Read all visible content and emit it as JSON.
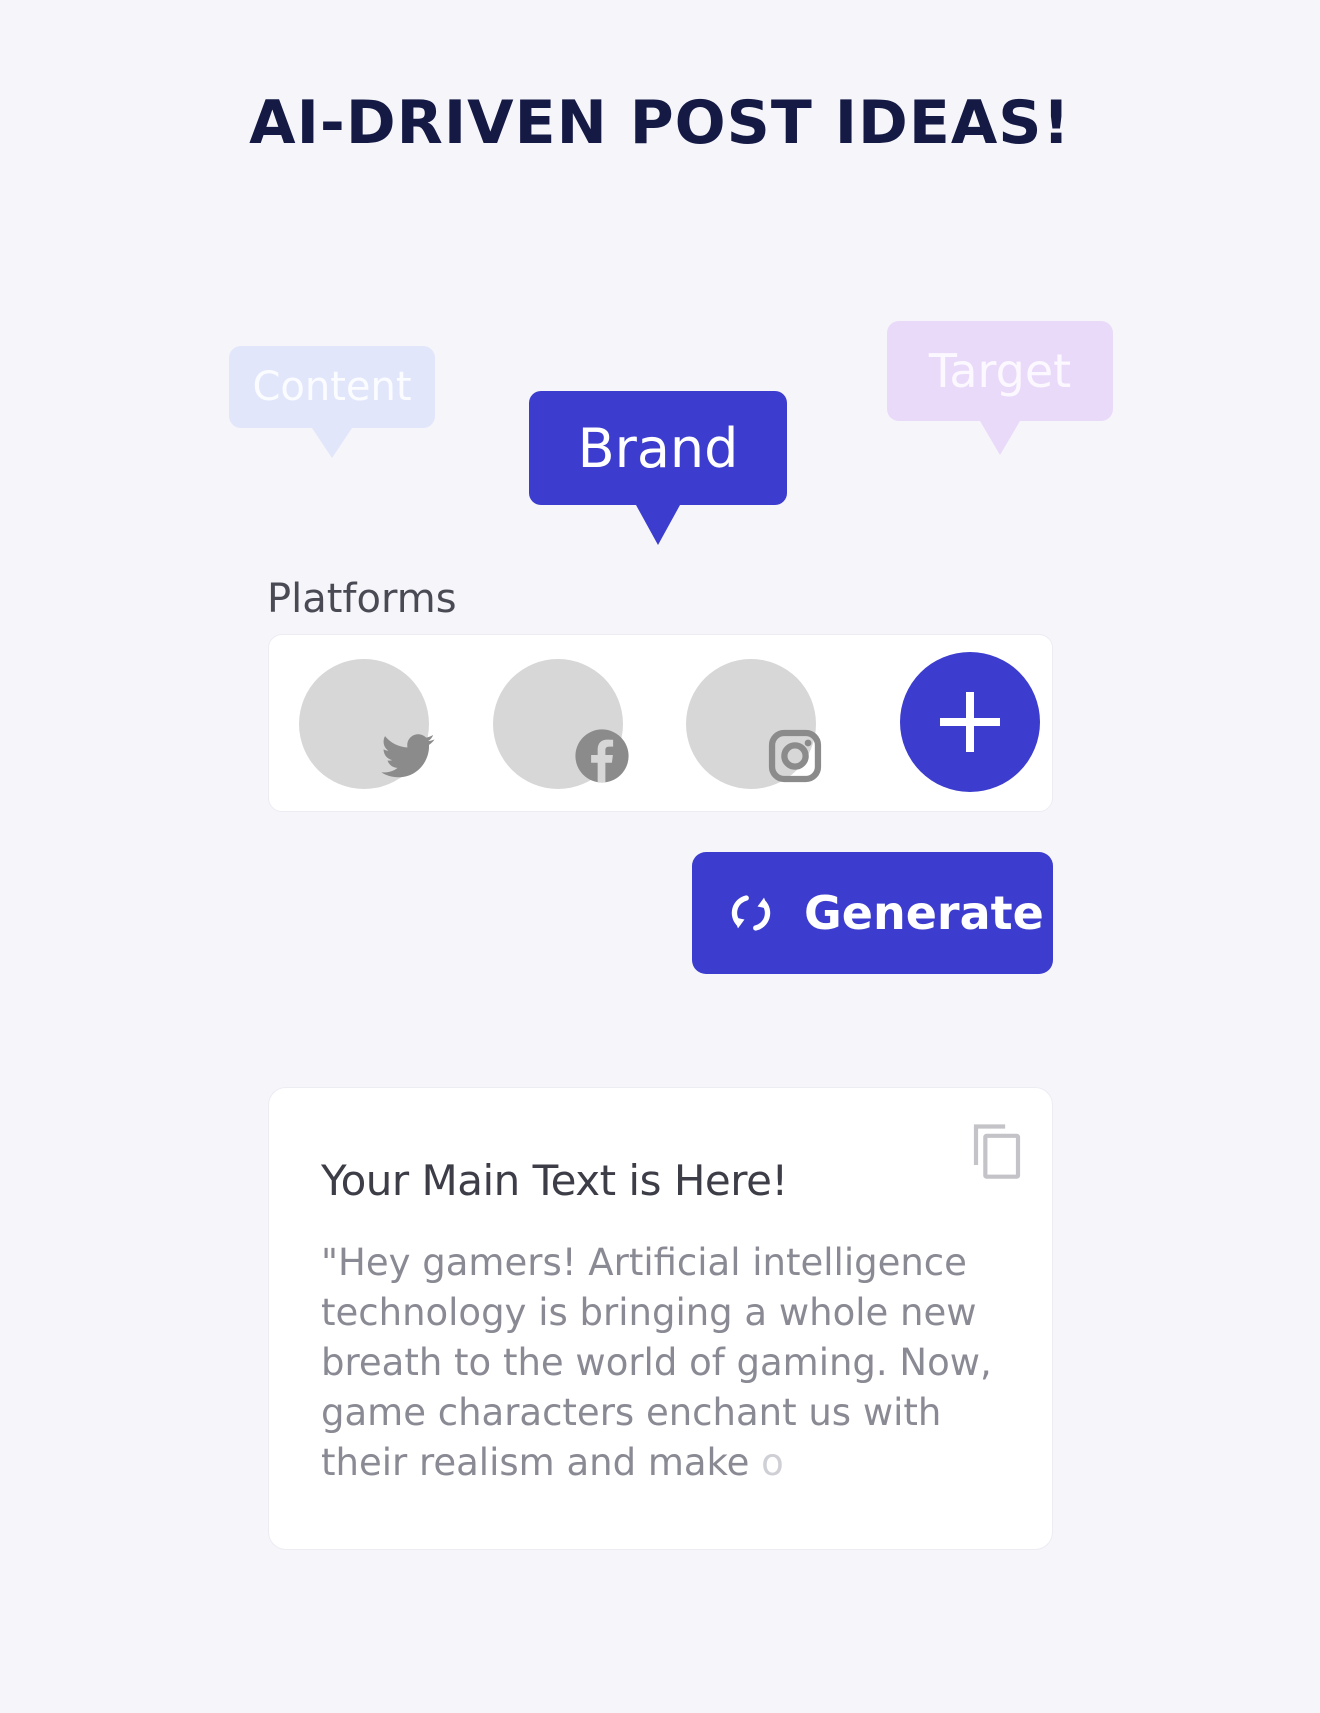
{
  "header": {
    "title": "AI-DRIVEN POST IDEAS!"
  },
  "tags": {
    "content": "Content",
    "brand": "Brand",
    "target": "Target"
  },
  "platforms": {
    "label": "Platforms",
    "items": [
      {
        "name": "Twitter",
        "icon": "twitter-icon"
      },
      {
        "name": "Facebook",
        "icon": "facebook-icon"
      },
      {
        "name": "Instagram",
        "icon": "instagram-icon"
      }
    ],
    "add_icon": "plus-icon"
  },
  "actions": {
    "generate_label": "Generate",
    "generate_icon": "refresh-icon"
  },
  "result": {
    "title": "Your Main Text is Here!",
    "body": "\"Hey gamers! Artificial intelligence technology is bringing a whole new breath to the world of gaming. Now, game characters enchant us with their realism and make ",
    "body_fade": "o",
    "copy_icon": "copy-icon"
  },
  "colors": {
    "accent": "#3c3ccf",
    "background": "#f5f5fa",
    "title": "#151a45",
    "content_tag": "#e2e6fb",
    "target_tag": "#e9daf9"
  }
}
